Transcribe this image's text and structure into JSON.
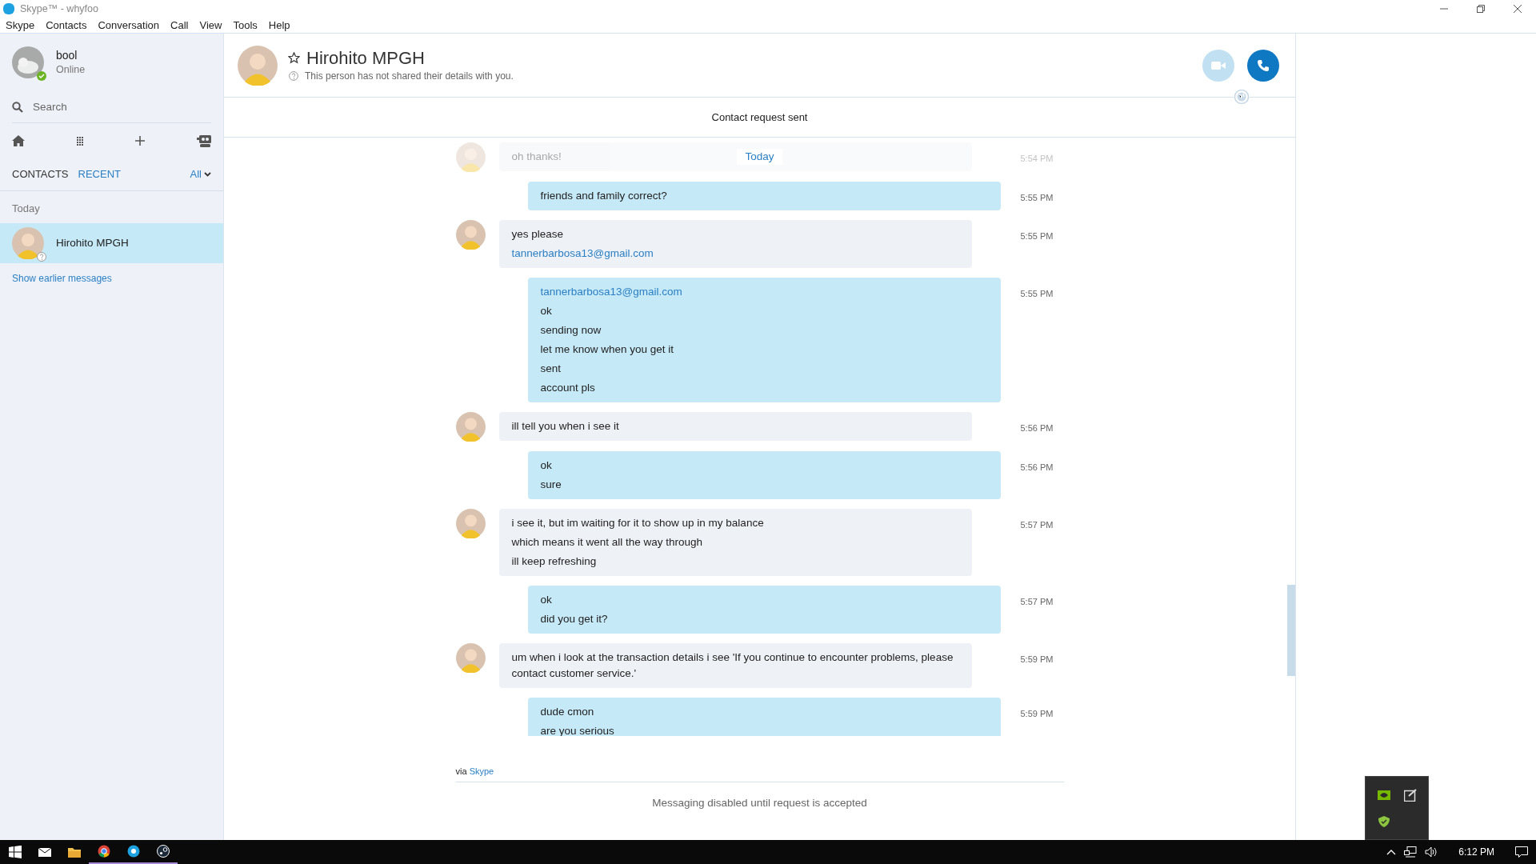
{
  "window": {
    "title": "Skype™ - whyfoo"
  },
  "menu": [
    "Skype",
    "Contacts",
    "Conversation",
    "Call",
    "View",
    "Tools",
    "Help"
  ],
  "profile": {
    "name": "bool",
    "status": "Online"
  },
  "search": {
    "placeholder": "Search"
  },
  "sidebar_tabs": [
    {
      "label": "CONTACTS",
      "selected": false
    },
    {
      "label": "RECENT",
      "selected": true
    }
  ],
  "filter": "All",
  "recent": {
    "section": "Today",
    "items": [
      {
        "name": "Hirohito MPGH",
        "selected": true
      }
    ],
    "show_earlier": "Show earlier messages"
  },
  "conversation": {
    "name": "Hirohito MPGH",
    "info": "This person has not shared their details with you.",
    "request_status": "Contact request sent",
    "date_label": "Today",
    "messages": [
      {
        "kind": "incoming",
        "faded": true,
        "lines": [
          {
            "kind": "text",
            "text": "oh thanks!"
          }
        ],
        "time": "5:54 PM"
      },
      {
        "kind": "outgoing",
        "faded": false,
        "lines": [
          {
            "kind": "text",
            "text": "friends and family correct?"
          }
        ],
        "time": "5:55 PM"
      },
      {
        "kind": "incoming",
        "faded": false,
        "lines": [
          {
            "kind": "text",
            "text": "yes please"
          },
          {
            "kind": "link",
            "text": "tannerbarbosa13@gmail.com"
          }
        ],
        "time": "5:55 PM"
      },
      {
        "kind": "outgoing",
        "faded": false,
        "lines": [
          {
            "kind": "link",
            "text": "tannerbarbosa13@gmail.com"
          },
          {
            "kind": "text",
            "text": "ok"
          },
          {
            "kind": "text",
            "text": "sending now"
          },
          {
            "kind": "text",
            "text": "let me know when you get it"
          },
          {
            "kind": "text",
            "text": "sent"
          },
          {
            "kind": "text",
            "text": "account pls"
          }
        ],
        "time": "5:55 PM"
      },
      {
        "kind": "incoming",
        "faded": false,
        "lines": [
          {
            "kind": "text",
            "text": "ill tell you when i see it"
          }
        ],
        "time": "5:56 PM"
      },
      {
        "kind": "outgoing",
        "faded": false,
        "lines": [
          {
            "kind": "text",
            "text": "ok"
          },
          {
            "kind": "text",
            "text": "sure"
          }
        ],
        "time": "5:56 PM"
      },
      {
        "kind": "incoming",
        "faded": false,
        "lines": [
          {
            "kind": "text",
            "text": "i see it, but im waiting for it to show up in my balance"
          },
          {
            "kind": "text",
            "text": "which means it went all the way through"
          },
          {
            "kind": "text",
            "text": "ill keep refreshing"
          }
        ],
        "time": "5:57 PM"
      },
      {
        "kind": "outgoing",
        "faded": false,
        "lines": [
          {
            "kind": "text",
            "text": "ok"
          },
          {
            "kind": "text",
            "text": "did you get it?"
          }
        ],
        "time": "5:57 PM"
      },
      {
        "kind": "incoming",
        "faded": false,
        "lines": [
          {
            "kind": "text",
            "text": "um when i look at the transaction details i see 'If you continue to encounter problems, please contact customer service.'"
          }
        ],
        "time": "5:59 PM"
      },
      {
        "kind": "outgoing",
        "faded": false,
        "lines": [
          {
            "kind": "text",
            "text": "dude cmon"
          },
          {
            "kind": "text",
            "text": "are you serious"
          }
        ],
        "time": "5:59 PM"
      }
    ],
    "via": {
      "prefix": "via",
      "link": "Skype"
    },
    "footer": "Messaging disabled until request is accepted"
  },
  "taskbar": {
    "clock": "6:12 PM"
  }
}
